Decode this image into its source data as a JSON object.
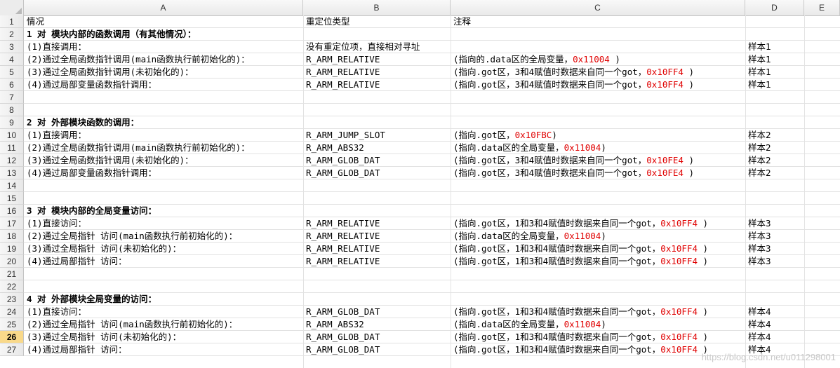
{
  "columns": [
    "A",
    "B",
    "C",
    "D",
    "E"
  ],
  "row_numbers": [
    "1",
    "2",
    "3",
    "4",
    "5",
    "6",
    "7",
    "8",
    "9",
    "10",
    "11",
    "12",
    "13",
    "14",
    "15",
    "16",
    "17",
    "18",
    "19",
    "20",
    "21",
    "22",
    "23",
    "24",
    "25",
    "26",
    "27"
  ],
  "active_row": "26",
  "rows": [
    {
      "a": "情况",
      "b": "重定位类型",
      "c": [
        {
          "t": "注释"
        }
      ],
      "d": "",
      "bold": false
    },
    {
      "a": "1 对  模块内部的函数调用（有其他情况）：",
      "b": "",
      "c": [],
      "d": "",
      "bold": true
    },
    {
      "a": "(1)直接调用：",
      "b": "没有重定位项，直接相对寻址",
      "c": [],
      "d": "样本1",
      "bold": false
    },
    {
      "a": "(2)通过全局函数指针调用(main函数执行前初始化的)：",
      "b": "R_ARM_RELATIVE",
      "c": [
        {
          "t": "(指向的.data区的全局变量，"
        },
        {
          "t": "0x11004",
          "red": true
        },
        {
          "t": " )"
        }
      ],
      "d": "样本1",
      "bold": false
    },
    {
      "a": "(3)通过全局函数指针调用(未初始化的)：",
      "b": "R_ARM_RELATIVE",
      "c": [
        {
          "t": "(指向.got区，3和4赋值时数据来自同一个got，"
        },
        {
          "t": "0x10FF4",
          "red": true
        },
        {
          "t": " )"
        }
      ],
      "d": "样本1",
      "bold": false
    },
    {
      "a": "(4)通过局部变量函数指针调用：",
      "b": "R_ARM_RELATIVE",
      "c": [
        {
          "t": "(指向.got区，3和4赋值时数据来自同一个got，"
        },
        {
          "t": "0x10FF4",
          "red": true
        },
        {
          "t": " )"
        }
      ],
      "d": "样本1",
      "bold": false
    },
    {
      "a": "",
      "b": "",
      "c": [],
      "d": "",
      "bold": false
    },
    {
      "a": "",
      "b": "",
      "c": [],
      "d": "",
      "bold": false
    },
    {
      "a": "2 对  外部模块函数的调用：",
      "b": "",
      "c": [],
      "d": "",
      "bold": true
    },
    {
      "a": "(1)直接调用：",
      "b": "R_ARM_JUMP_SLOT",
      "c": [
        {
          "t": "(指向.got区，"
        },
        {
          "t": "0x10FBC",
          "red": true
        },
        {
          "t": ")"
        }
      ],
      "d": "样本2",
      "bold": false
    },
    {
      "a": "(2)通过全局函数指针调用(main函数执行前初始化的)：",
      "b": "R_ARM_ABS32",
      "c": [
        {
          "t": "(指向.data区的全局变量，"
        },
        {
          "t": "0x11004",
          "red": true
        },
        {
          "t": ")"
        }
      ],
      "d": "样本2",
      "bold": false
    },
    {
      "a": "(3)通过全局函数指针调用(未初始化的)：",
      "b": "R_ARM_GLOB_DAT",
      "c": [
        {
          "t": "(指向.got区，3和4赋值时数据来自同一个got，"
        },
        {
          "t": "0x10FE4",
          "red": true
        },
        {
          "t": " )"
        }
      ],
      "d": "样本2",
      "bold": false
    },
    {
      "a": "(4)通过局部变量函数指针调用：",
      "b": "R_ARM_GLOB_DAT",
      "c": [
        {
          "t": "(指向.got区，3和4赋值时数据来自同一个got，"
        },
        {
          "t": "0x10FE4",
          "red": true
        },
        {
          "t": " )"
        }
      ],
      "d": "样本2",
      "bold": false
    },
    {
      "a": "",
      "b": "",
      "c": [],
      "d": "",
      "bold": false
    },
    {
      "a": "",
      "b": "",
      "c": [],
      "d": "",
      "bold": false
    },
    {
      "a": "3 对  模块内部的全局变量访问：",
      "b": "",
      "c": [],
      "d": "",
      "bold": true
    },
    {
      "a": "(1)直接访问：",
      "b": "R_ARM_RELATIVE",
      "c": [
        {
          "t": "(指向.got区，1和3和4赋值时数据来自同一个got，"
        },
        {
          "t": "0x10FF4",
          "red": true
        },
        {
          "t": " )"
        }
      ],
      "d": "样本3",
      "bold": false
    },
    {
      "a": "(2)通过全局指针 访问(main函数执行前初始化的)：",
      "b": "R_ARM_RELATIVE",
      "c": [
        {
          "t": "(指向.data区的全局变量，"
        },
        {
          "t": "0x11004",
          "red": true
        },
        {
          "t": ")"
        }
      ],
      "d": "样本3",
      "bold": false
    },
    {
      "a": "(3)通过全局指针 访问(未初始化的)：",
      "b": "R_ARM_RELATIVE",
      "c": [
        {
          "t": "(指向.got区，1和3和4赋值时数据来自同一个got，"
        },
        {
          "t": "0x10FF4",
          "red": true
        },
        {
          "t": " )"
        }
      ],
      "d": "样本3",
      "bold": false
    },
    {
      "a": "(4)通过局部指针 访问：",
      "b": "R_ARM_RELATIVE",
      "c": [
        {
          "t": "(指向.got区，1和3和4赋值时数据来自同一个got，"
        },
        {
          "t": "0x10FF4",
          "red": true
        },
        {
          "t": " )"
        }
      ],
      "d": "样本3",
      "bold": false
    },
    {
      "a": "",
      "b": "",
      "c": [],
      "d": "",
      "bold": false
    },
    {
      "a": "",
      "b": "",
      "c": [],
      "d": "",
      "bold": false
    },
    {
      "a": "4 对  外部模块全局变量的访问：",
      "b": "",
      "c": [],
      "d": "",
      "bold": true
    },
    {
      "a": "(1)直接访问：",
      "b": "R_ARM_GLOB_DAT",
      "c": [
        {
          "t": "(指向.got区，1和3和4赋值时数据来自同一个got，"
        },
        {
          "t": "0x10FF4",
          "red": true
        },
        {
          "t": " )"
        }
      ],
      "d": "样本4",
      "bold": false
    },
    {
      "a": "(2)通过全局指针 访问(main函数执行前初始化的)：",
      "b": "R_ARM_ABS32",
      "c": [
        {
          "t": "(指向.data区的全局变量，"
        },
        {
          "t": "0x11004",
          "red": true
        },
        {
          "t": ")"
        }
      ],
      "d": "样本4",
      "bold": false
    },
    {
      "a": "(3)通过全局指针 访问(未初始化的)：",
      "b": "R_ARM_GLOB_DAT",
      "c": [
        {
          "t": "(指向.got区，1和3和4赋值时数据来自同一个got，"
        },
        {
          "t": "0x10FF4",
          "red": true
        },
        {
          "t": " )"
        }
      ],
      "d": "样本4",
      "bold": false
    },
    {
      "a": "(4)通过局部指针 访问：",
      "b": "R_ARM_GLOB_DAT",
      "c": [
        {
          "t": "(指向.got区，1和3和4赋值时数据来自同一个got，"
        },
        {
          "t": "0x10FF4",
          "red": true
        },
        {
          "t": " )"
        }
      ],
      "d": "样本4",
      "bold": false
    }
  ],
  "watermark": "https://blog.csdn.net/u011298001",
  "colors": {
    "highlight_text": "#e00000",
    "active_row_header": "#f9d98a"
  }
}
